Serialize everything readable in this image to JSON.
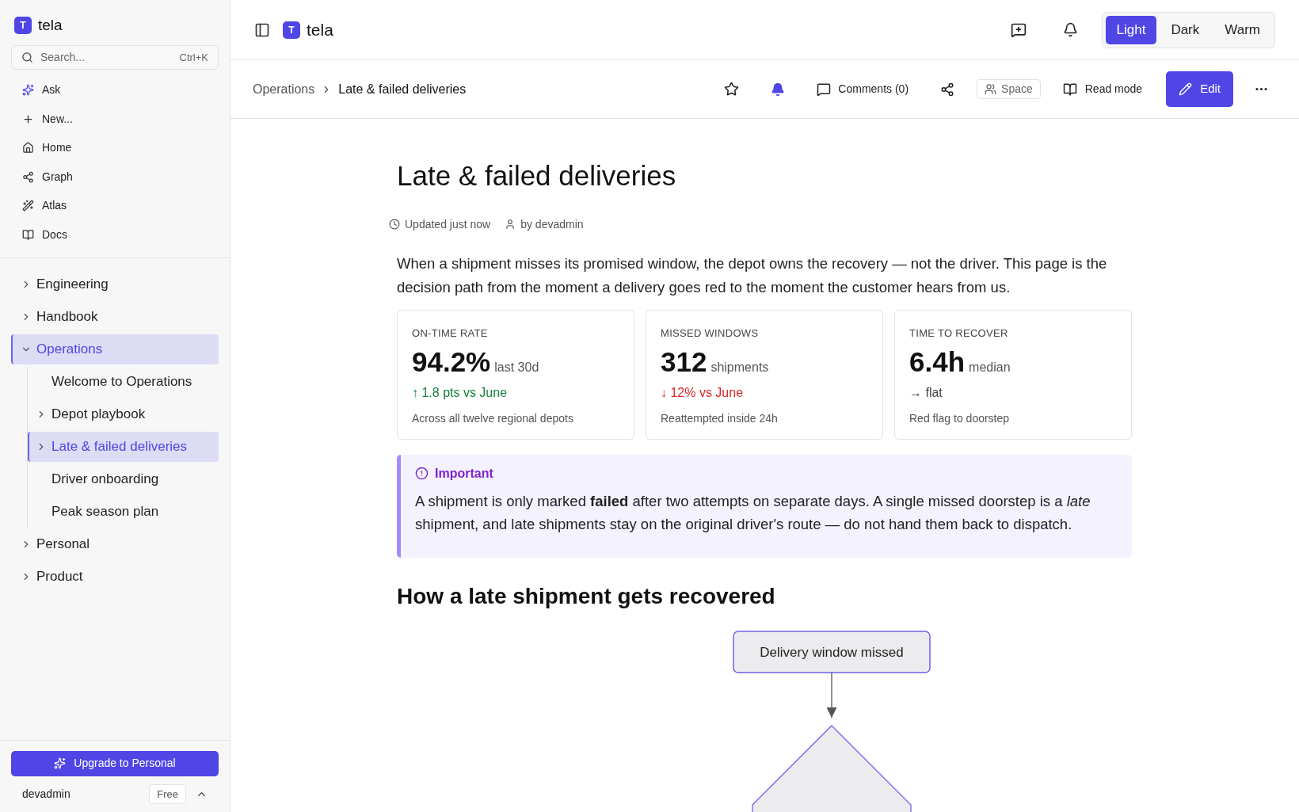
{
  "sidebar": {
    "logo": {
      "letter": "T",
      "name": "tela"
    },
    "search": {
      "placeholder": "Search...",
      "shortcut": "Ctrl+K"
    },
    "nav": [
      {
        "label": "Ask"
      },
      {
        "label": "New..."
      },
      {
        "label": "Home"
      },
      {
        "label": "Graph"
      },
      {
        "label": "Atlas"
      },
      {
        "label": "Docs"
      }
    ],
    "tree": [
      {
        "label": "Engineering",
        "kind": "folder",
        "expanded": false,
        "selected": false
      },
      {
        "label": "Handbook",
        "kind": "folder",
        "expanded": false,
        "selected": false
      },
      {
        "label": "Operations",
        "kind": "folder",
        "expanded": true,
        "selected": true,
        "children": [
          {
            "label": "Welcome to Operations",
            "kind": "page",
            "selected": false
          },
          {
            "label": "Depot playbook",
            "kind": "folder",
            "expanded": false,
            "selected": false
          },
          {
            "label": "Late & failed deliveries",
            "kind": "folder",
            "expanded": false,
            "selected": true
          },
          {
            "label": "Driver onboarding",
            "kind": "page",
            "selected": false
          },
          {
            "label": "Peak season plan",
            "kind": "page",
            "selected": false
          }
        ]
      },
      {
        "label": "Personal",
        "kind": "folder",
        "expanded": false,
        "selected": false
      },
      {
        "label": "Product",
        "kind": "folder",
        "expanded": false,
        "selected": false
      }
    ],
    "upgrade_button": "Upgrade to Personal",
    "user": {
      "name": "devadmin",
      "plan": "Free"
    }
  },
  "header": {
    "logo": {
      "letter": "T",
      "name": "tela"
    },
    "themes": [
      {
        "label": "Light",
        "selected": true
      },
      {
        "label": "Dark",
        "selected": false
      },
      {
        "label": "Warm",
        "selected": false
      }
    ]
  },
  "page_bar": {
    "breadcrumb": [
      "Operations",
      "Late & failed deliveries"
    ],
    "watching": true,
    "comments": "Comments (0)",
    "space": "Space",
    "read_mode": "Read mode",
    "edit": "Edit"
  },
  "article": {
    "title": "Late & failed deliveries",
    "updated": "Updated just now",
    "author": "by devadmin",
    "intro": "When a shipment misses its promised window, the depot owns the recovery — not the driver. This page is the decision path from the moment a delivery goes red to the moment the customer hears from us.",
    "metrics": [
      {
        "label": "ON-TIME RATE",
        "value": "94.2%",
        "unit": "last 30d",
        "trend": "↑ 1.8 pts vs June",
        "kind": "up",
        "note": "Across all twelve regional depots"
      },
      {
        "label": "MISSED WINDOWS",
        "value": "312",
        "unit": "shipments",
        "trend": "↓ 12% vs June",
        "kind": "down",
        "note": "Reattempted inside 24h"
      },
      {
        "label": "TIME TO RECOVER",
        "value": "6.4h",
        "unit": "median",
        "trend": "→ flat",
        "kind": "flat",
        "note": "Red flag to doorstep"
      }
    ],
    "callout": {
      "title": "Important",
      "text": "A shipment is only marked **failed** after two attempts on separate days. A single missed doorstep is a *late* shipment, and late shipments stay on the original driver's route — do not hand them back to dispatch."
    },
    "section_heading": "How a late shipment gets recovered",
    "flowchart": [
      {
        "kind": "process",
        "label": "Delivery window missed"
      },
      {
        "kind": "decision"
      }
    ]
  }
}
